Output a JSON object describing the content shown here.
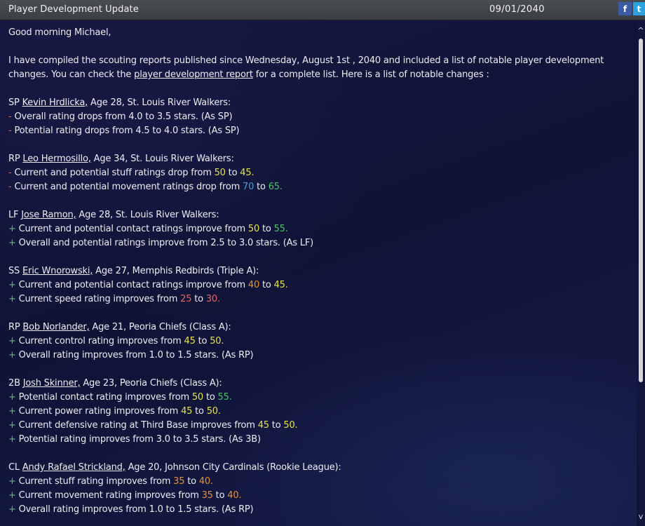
{
  "header": {
    "title": "Player Development Update",
    "date": "09/01/2040",
    "facebook_glyph": "f",
    "twitter_glyph": "t"
  },
  "scroll": {
    "up": "^",
    "down": "v"
  },
  "intro": {
    "greeting": "Good morning Michael,",
    "p1_line1": "I have compiled the scouting reports published since Wednesday, August 1st , 2040 and included a list of notable player development",
    "p1_line2_a": "changes. You can check the ",
    "p1_line2_link": "player development report",
    "p1_line2_b": " for a complete list. Here is a list of notable changes :"
  },
  "players": [
    {
      "pos": "SP ",
      "name": "Kevin Hrdlicka,",
      "info": " Age 28, St. Louis River Walkers:",
      "changes": [
        {
          "sign": "- ",
          "text": "Overall rating drops from ",
          "v1": "4.0",
          "mid": " to ",
          "v2": "3.5",
          "tail": " stars. (As SP)"
        },
        {
          "sign": "- ",
          "text": "Potential rating drops from ",
          "v1": "4.5",
          "mid": " to ",
          "v2": "4.0",
          "tail": " stars. (As SP)"
        }
      ]
    },
    {
      "pos": "RP ",
      "name": "Leo Hermosillo,",
      "info": " Age 34, St. Louis River Walkers:",
      "changes": [
        {
          "sign": "- ",
          "text": "Current and potential stuff ratings drop from ",
          "v1": "50",
          "mid": " to ",
          "v2": "45",
          "tail": "."
        },
        {
          "sign": "- ",
          "text": "Current and potential movement ratings drop from ",
          "v1": "70",
          "mid": " to ",
          "v2": "65",
          "tail": "."
        }
      ]
    },
    {
      "pos": "LF ",
      "name": "Jose Ramon,",
      "info": " Age 28, St. Louis River Walkers:",
      "changes": [
        {
          "sign": "+ ",
          "text": "Current and potential contact ratings improve from ",
          "v1": "50",
          "mid": " to ",
          "v2": "55",
          "tail": "."
        },
        {
          "sign": "+ ",
          "text": "Overall and potential ratings improve from ",
          "v1": "2.5",
          "mid": " to ",
          "v2": "3.0",
          "tail": " stars. (As LF)"
        }
      ]
    },
    {
      "pos": "SS ",
      "name": "Eric Wnorowski,",
      "info": " Age 27, Memphis Redbirds (Triple A):",
      "changes": [
        {
          "sign": "+ ",
          "text": "Current and potential contact ratings improve from ",
          "v1": "40",
          "mid": " to ",
          "v2": "45",
          "tail": "."
        },
        {
          "sign": "+ ",
          "text": "Current speed rating improves from ",
          "v1": "25",
          "mid": " to ",
          "v2": "30",
          "tail": "."
        }
      ]
    },
    {
      "pos": "RP ",
      "name": "Bob Norlander,",
      "info": " Age 21, Peoria Chiefs (Class A):",
      "changes": [
        {
          "sign": "+ ",
          "text": "Current control rating improves from ",
          "v1": "45",
          "mid": " to ",
          "v2": "50",
          "tail": "."
        },
        {
          "sign": "+ ",
          "text": "Overall rating improves from ",
          "v1": "1.0",
          "mid": " to ",
          "v2": "1.5",
          "tail": " stars. (As RP)"
        }
      ]
    },
    {
      "pos": "2B ",
      "name": "Josh Skinner,",
      "info": " Age 23, Peoria Chiefs (Class A):",
      "changes": [
        {
          "sign": "+ ",
          "text": "Potential contact rating improves from ",
          "v1": "50",
          "mid": " to ",
          "v2": "55",
          "tail": "."
        },
        {
          "sign": "+ ",
          "text": "Current power rating improves from ",
          "v1": "45",
          "mid": " to ",
          "v2": "50",
          "tail": "."
        },
        {
          "sign": "+ ",
          "text": "Current defensive rating at Third Base improves from ",
          "v1": "45",
          "mid": " to ",
          "v2": "50",
          "tail": "."
        },
        {
          "sign": "+ ",
          "text": "Potential rating improves from ",
          "v1": "3.0",
          "mid": " to ",
          "v2": "3.5",
          "tail": " stars. (As 3B)"
        }
      ]
    },
    {
      "pos": "CL ",
      "name": "Andy Rafael Strickland,",
      "info": " Age 20, Johnson City Cardinals (Rookie League):",
      "changes": [
        {
          "sign": "+ ",
          "text": "Current stuff rating improves from ",
          "v1": "35",
          "mid": " to ",
          "v2": "40",
          "tail": "."
        },
        {
          "sign": "+ ",
          "text": "Current movement rating improves from ",
          "v1": "35",
          "mid": " to ",
          "v2": "40",
          "tail": "."
        },
        {
          "sign": "+ ",
          "text": "Overall rating improves from ",
          "v1": "1.0",
          "mid": " to ",
          "v2": "1.5",
          "tail": " stars. (As RP)"
        }
      ]
    }
  ],
  "colors": {
    "background": "#0f1336",
    "minus": "#e06a5e",
    "plus": "#5fc06b",
    "rating_yellow": "#e6e24a",
    "rating_teal": "#4a9dc9",
    "rating_green": "#4fbf6e",
    "rating_orange": "#e8902e",
    "rating_red": "#f06060"
  }
}
